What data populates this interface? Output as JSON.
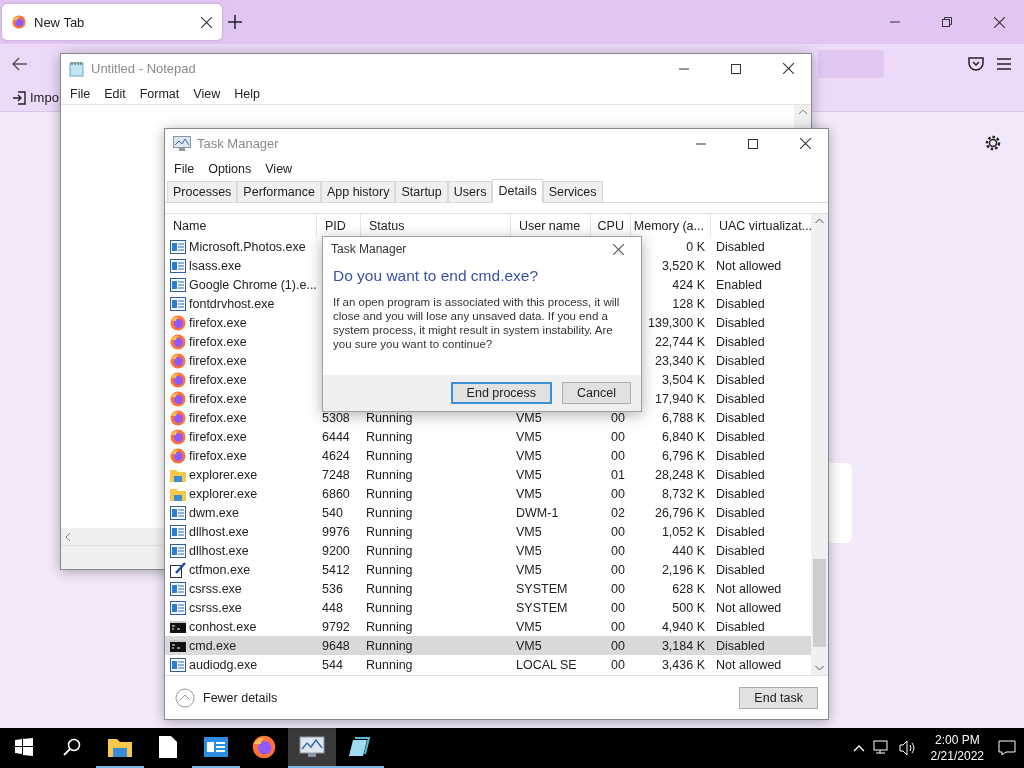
{
  "browser": {
    "tab": {
      "title": "New Tab",
      "selected": true
    },
    "bookmark": "Impo"
  },
  "notepad": {
    "title": "Untitled - Notepad",
    "menu": [
      "File",
      "Edit",
      "Format",
      "View",
      "Help"
    ]
  },
  "task_manager": {
    "title": "Task Manager",
    "menu": [
      "File",
      "Options",
      "View"
    ],
    "tabs": [
      {
        "label": "Processes",
        "selected": false
      },
      {
        "label": "Performance",
        "selected": false
      },
      {
        "label": "App history",
        "selected": false
      },
      {
        "label": "Startup",
        "selected": false
      },
      {
        "label": "Users",
        "selected": false
      },
      {
        "label": "Details",
        "selected": true
      },
      {
        "label": "Services",
        "selected": false
      }
    ],
    "columns": [
      "Name",
      "PID",
      "Status",
      "User name",
      "CPU",
      "Memory (a...",
      "UAC virtualizat..."
    ],
    "rows": [
      {
        "kind": "app",
        "name": "Microsoft.Photos.exe",
        "memory": "0 K",
        "uac": "Disabled",
        "selected": false
      },
      {
        "kind": "app",
        "name": "lsass.exe",
        "memory": "3,520 K",
        "uac": "Not allowed",
        "selected": false
      },
      {
        "kind": "app",
        "name": "Google Chrome (1).e...",
        "memory": "424 K",
        "uac": "Enabled",
        "selected": false
      },
      {
        "kind": "app",
        "name": "fontdrvhost.exe",
        "memory": "128 K",
        "uac": "Disabled",
        "selected": false
      },
      {
        "kind": "firefox",
        "name": "firefox.exe",
        "memory": "139,300 K",
        "uac": "Disabled",
        "selected": false
      },
      {
        "kind": "firefox",
        "name": "firefox.exe",
        "memory": "22,744 K",
        "uac": "Disabled",
        "selected": false
      },
      {
        "kind": "firefox",
        "name": "firefox.exe",
        "memory": "23,340 K",
        "uac": "Disabled",
        "selected": false
      },
      {
        "kind": "firefox",
        "name": "firefox.exe",
        "memory": "3,504 K",
        "uac": "Disabled",
        "selected": false
      },
      {
        "kind": "firefox",
        "name": "firefox.exe",
        "memory": "17,940 K",
        "uac": "Disabled",
        "selected": false
      },
      {
        "kind": "firefox",
        "name": "firefox.exe",
        "pid": "5308",
        "status": "Running",
        "user": "VM5",
        "cpu": "00",
        "memory": "6,788 K",
        "uac": "Disabled",
        "selected": false
      },
      {
        "kind": "firefox",
        "name": "firefox.exe",
        "pid": "6444",
        "status": "Running",
        "user": "VM5",
        "cpu": "00",
        "memory": "6,840 K",
        "uac": "Disabled",
        "selected": false
      },
      {
        "kind": "firefox",
        "name": "firefox.exe",
        "pid": "4624",
        "status": "Running",
        "user": "VM5",
        "cpu": "00",
        "memory": "6,796 K",
        "uac": "Disabled",
        "selected": false
      },
      {
        "kind": "folder",
        "name": "explorer.exe",
        "pid": "7248",
        "status": "Running",
        "user": "VM5",
        "cpu": "01",
        "memory": "28,248 K",
        "uac": "Disabled",
        "selected": false
      },
      {
        "kind": "folder",
        "name": "explorer.exe",
        "pid": "6860",
        "status": "Running",
        "user": "VM5",
        "cpu": "00",
        "memory": "8,732 K",
        "uac": "Disabled",
        "selected": false
      },
      {
        "kind": "app",
        "name": "dwm.exe",
        "pid": "540",
        "status": "Running",
        "user": "DWM-1",
        "cpu": "02",
        "memory": "26,796 K",
        "uac": "Disabled",
        "selected": false
      },
      {
        "kind": "app",
        "name": "dllhost.exe",
        "pid": "9976",
        "status": "Running",
        "user": "VM5",
        "cpu": "00",
        "memory": "1,052 K",
        "uac": "Disabled",
        "selected": false
      },
      {
        "kind": "app",
        "name": "dllhost.exe",
        "pid": "9200",
        "status": "Running",
        "user": "VM5",
        "cpu": "00",
        "memory": "440 K",
        "uac": "Disabled",
        "selected": false
      },
      {
        "kind": "pen",
        "name": "ctfmon.exe",
        "pid": "5412",
        "status": "Running",
        "user": "VM5",
        "cpu": "00",
        "memory": "2,196 K",
        "uac": "Disabled",
        "selected": false
      },
      {
        "kind": "app",
        "name": "csrss.exe",
        "pid": "536",
        "status": "Running",
        "user": "SYSTEM",
        "cpu": "00",
        "memory": "628 K",
        "uac": "Not allowed",
        "selected": false
      },
      {
        "kind": "app",
        "name": "csrss.exe",
        "pid": "448",
        "status": "Running",
        "user": "SYSTEM",
        "cpu": "00",
        "memory": "500 K",
        "uac": "Not allowed",
        "selected": false
      },
      {
        "kind": "console",
        "name": "conhost.exe",
        "pid": "9792",
        "status": "Running",
        "user": "VM5",
        "cpu": "00",
        "memory": "4,940 K",
        "uac": "Disabled",
        "selected": false
      },
      {
        "kind": "console",
        "name": "cmd.exe",
        "pid": "9648",
        "status": "Running",
        "user": "VM5",
        "cpu": "00",
        "memory": "3,184 K",
        "uac": "Disabled",
        "selected": true
      },
      {
        "kind": "app",
        "name": "audiodg.exe",
        "pid": "544",
        "status": "Running",
        "user": "LOCAL SE",
        "cpu": "00",
        "memory": "3,436 K",
        "uac": "Not allowed",
        "selected": false
      }
    ],
    "fewer_details": "Fewer details",
    "end_task": "End task"
  },
  "dialog": {
    "title": "Task Manager",
    "heading": "Do you want to end cmd.exe?",
    "message": "If an open program is associated with this process, it will close and you will lose any unsaved data. If you end a system process, it might result in system instability. Are you sure you want to continue?",
    "buttons": [
      {
        "label": "End process",
        "default": true
      },
      {
        "label": "Cancel",
        "default": false
      }
    ]
  },
  "taskbar": {
    "apps": [
      {
        "kind": "folder",
        "running": true,
        "selected": false
      },
      {
        "kind": "file",
        "running": false,
        "selected": false
      },
      {
        "kind": "card",
        "running": true,
        "selected": false
      },
      {
        "kind": "firefox",
        "running": false,
        "selected": false
      },
      {
        "kind": "monitor",
        "running": true,
        "selected": true
      },
      {
        "kind": "notepad",
        "running": true,
        "selected": false
      }
    ],
    "time": "2:00 PM",
    "date": "2/21/2022"
  }
}
